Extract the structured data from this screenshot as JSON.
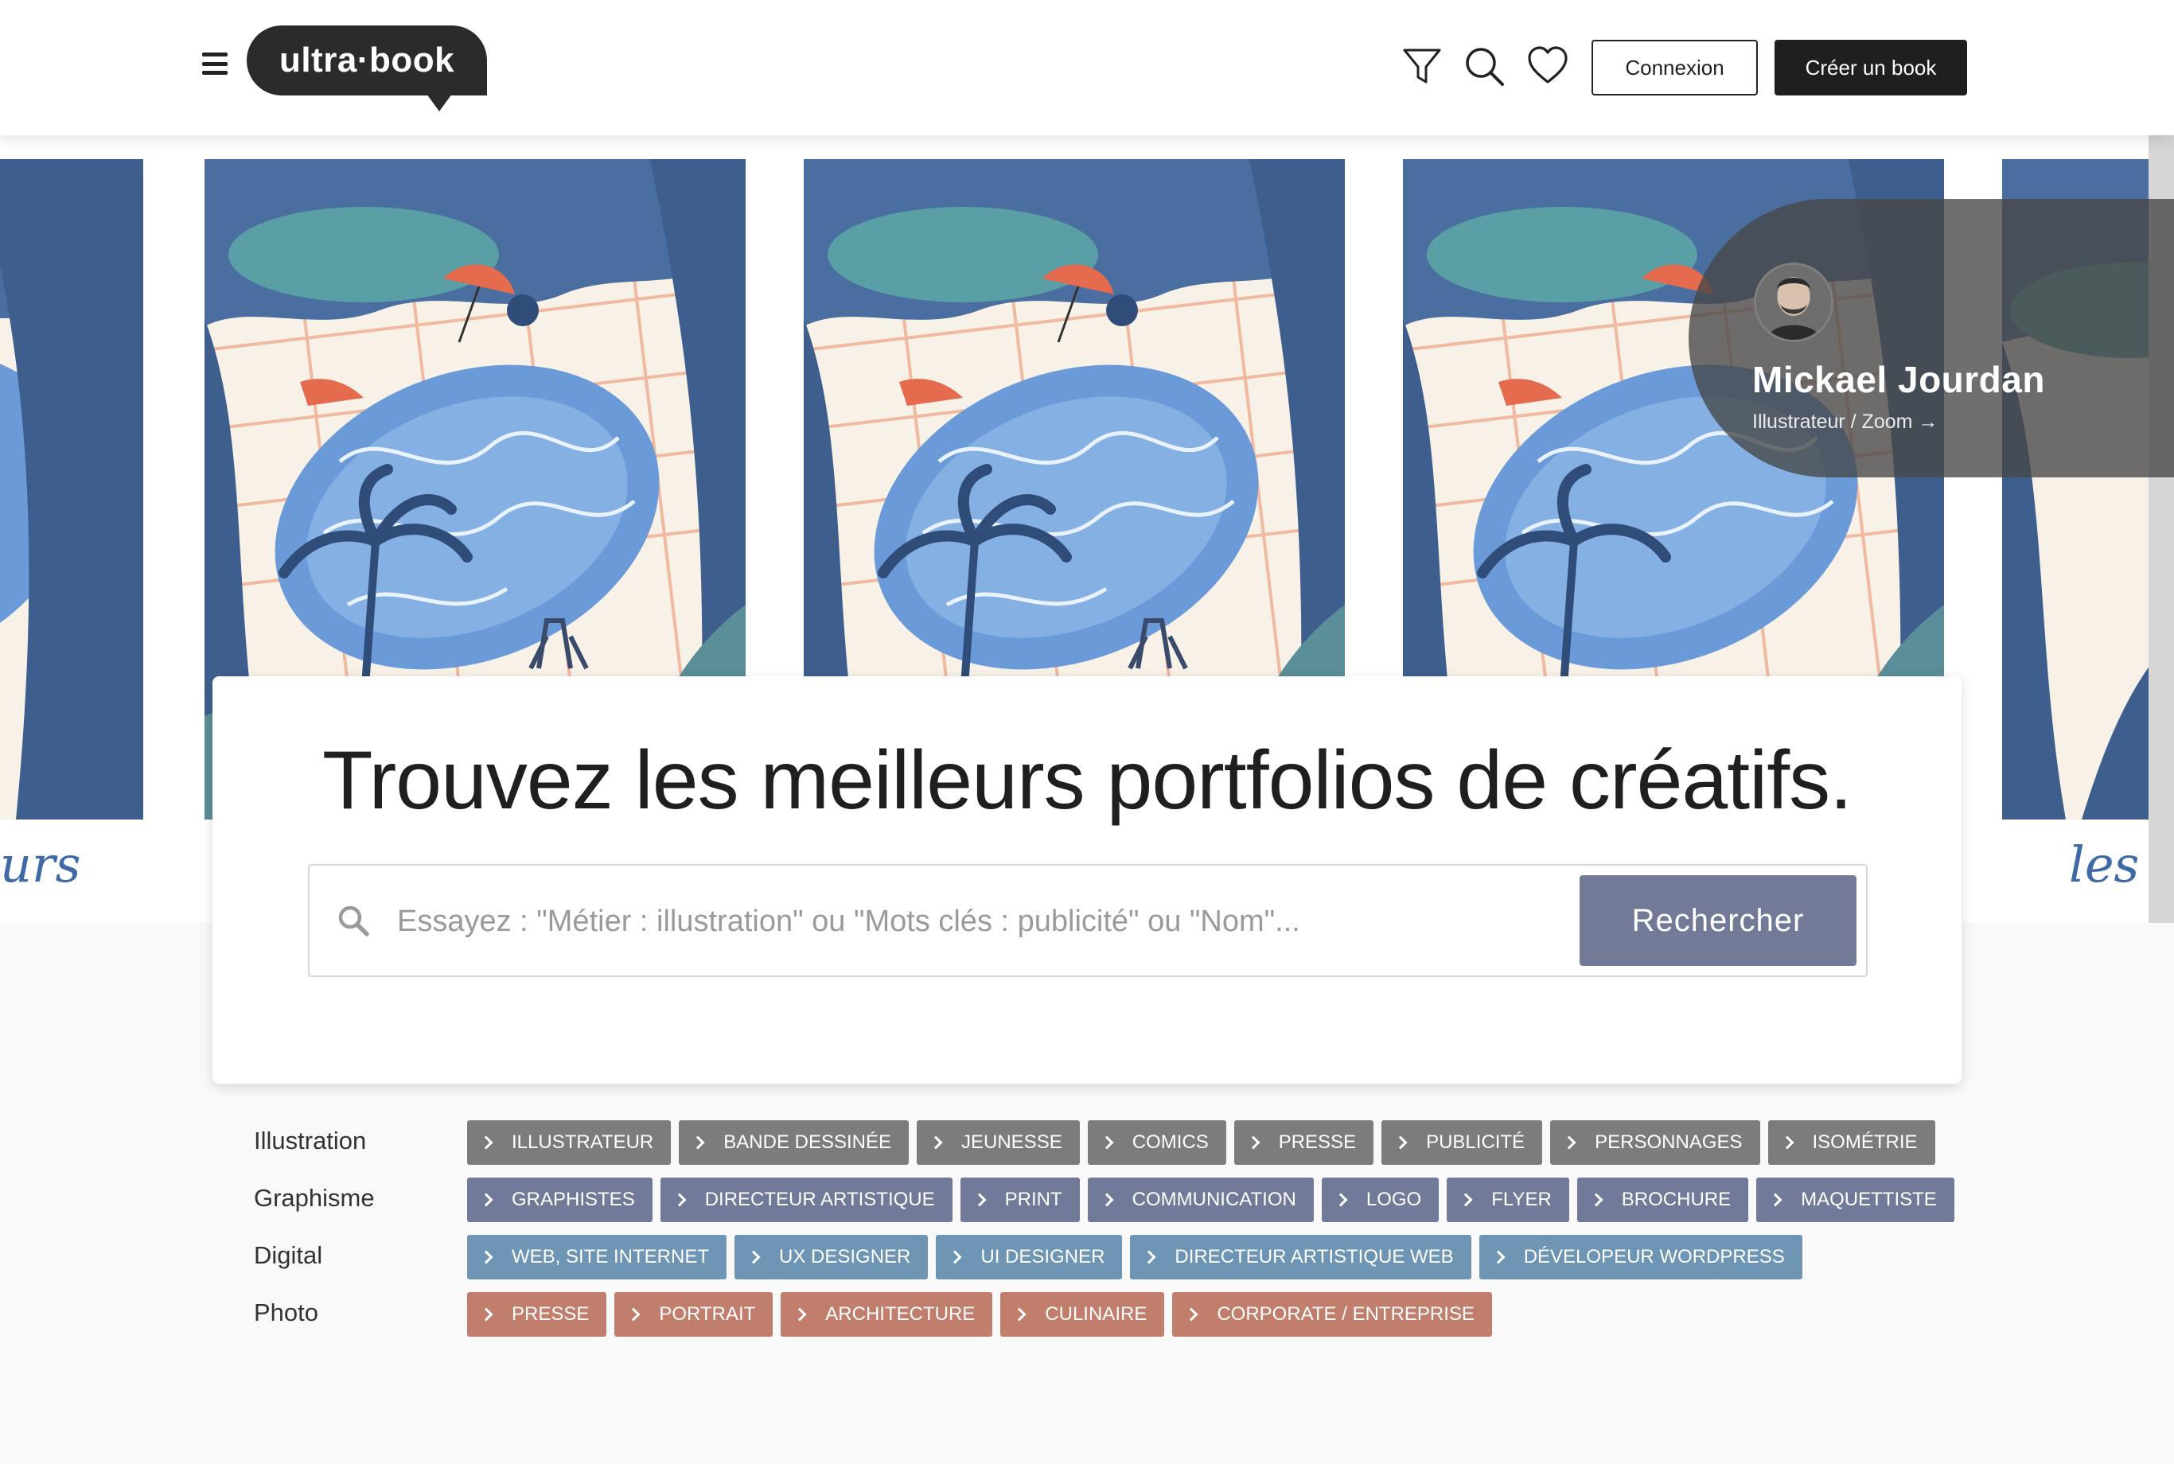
{
  "header": {
    "logo_text": "ultra·book",
    "login_label": "Connexion",
    "create_label": "Créer un book",
    "icons": [
      "menu-icon",
      "filter-icon",
      "search-icon",
      "heart-icon"
    ]
  },
  "hero": {
    "artist_name": "Mickael Jourdan",
    "artist_role": "Illustrateur / Zoom →",
    "script_left": "urs",
    "script_right": "les"
  },
  "search": {
    "headline": "Trouvez les meilleurs portfolios de créatifs.",
    "placeholder": "Essayez : \"Métier : illustration\" ou \"Mots clés : publicité\" ou \"Nom\"...",
    "button_label": "Rechercher"
  },
  "categories": [
    {
      "label": "Illustration",
      "color": "#7c7c7c",
      "tags": [
        "ILLUSTRATEUR",
        "BANDE DESSINÉE",
        "JEUNESSE",
        "COMICS",
        "PRESSE",
        "PUBLICITÉ",
        "PERSONNAGES",
        "ISOMÉTRIE"
      ]
    },
    {
      "label": "Graphisme",
      "color": "#727a99",
      "tags": [
        "GRAPHISTES",
        "DIRECTEUR ARTISTIQUE",
        "PRINT",
        "COMMUNICATION",
        "LOGO",
        "FLYER",
        "BROCHURE",
        "MAQUETTISTE"
      ]
    },
    {
      "label": "Digital",
      "color": "#6e95b3",
      "tags": [
        "WEB, SITE INTERNET",
        "UX DESIGNER",
        "UI DESIGNER",
        "DIRECTEUR ARTISTIQUE WEB",
        "DÉVELOPEUR WORDPRESS"
      ]
    },
    {
      "label": "Photo",
      "color": "#c17e6c",
      "tags": [
        "PRESSE",
        "PORTRAIT",
        "ARCHITECTURE",
        "CULINAIRE",
        "CORPORATE / ENTREPRISE"
      ]
    }
  ]
}
